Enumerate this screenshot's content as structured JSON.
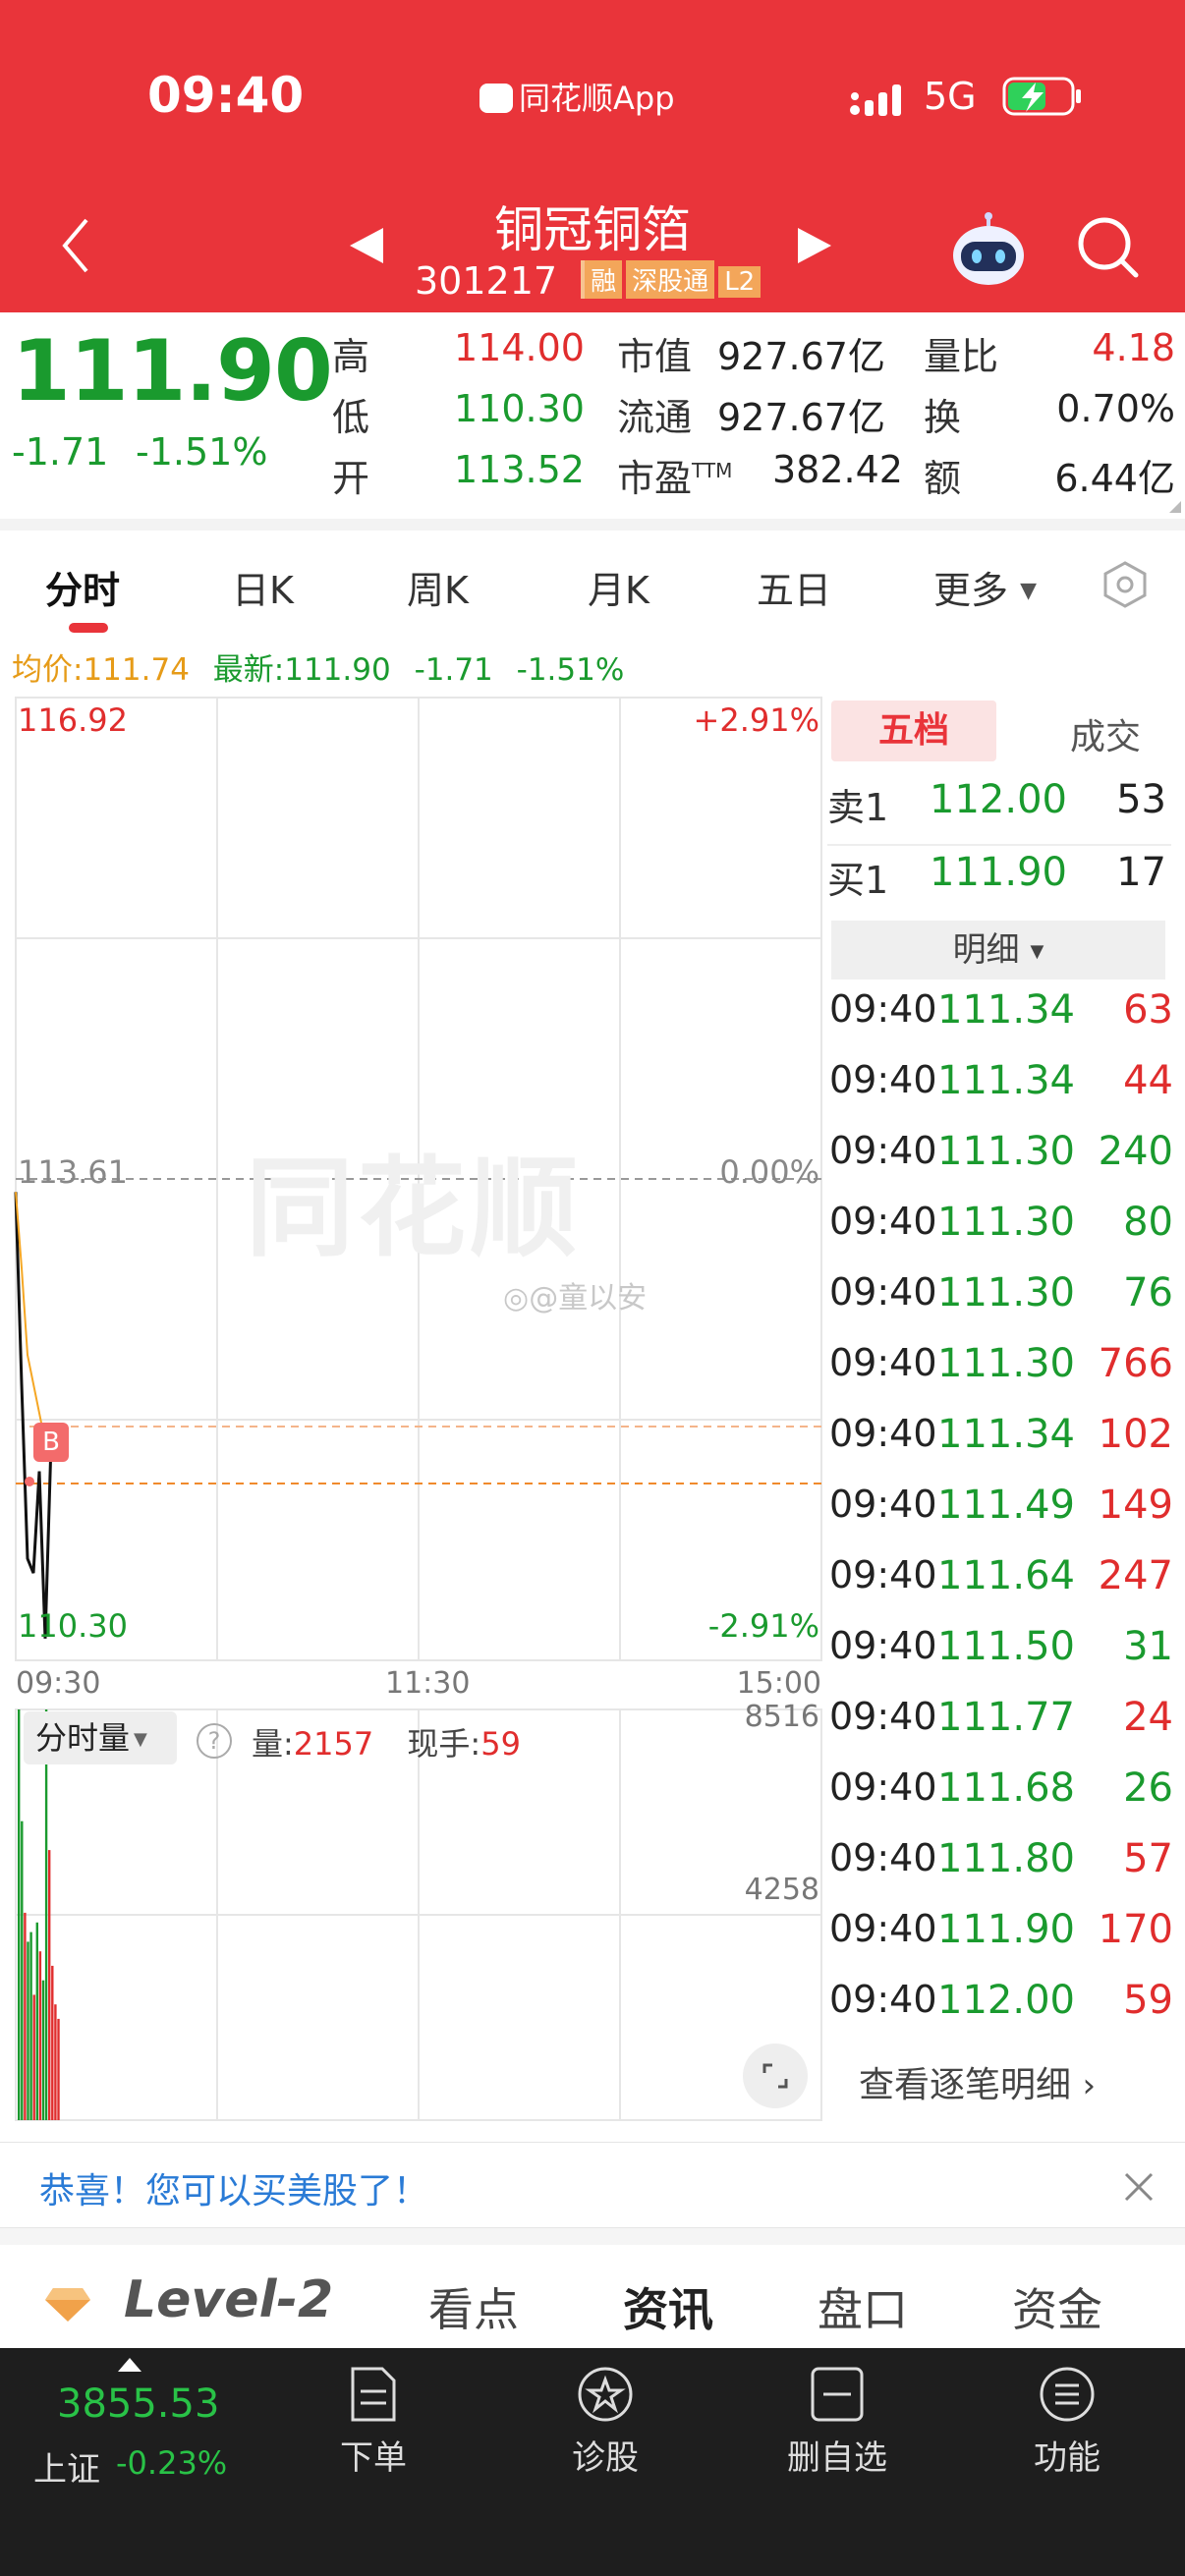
{
  "status_bar": {
    "time": "09:40",
    "app_name": "同花顺App",
    "network": "5G"
  },
  "header": {
    "stock_name": "铜冠铜箔",
    "stock_code": "301217",
    "badges": [
      "融",
      "深股通",
      "L2"
    ]
  },
  "quote": {
    "price": "111.90",
    "change": "-1.71",
    "change_pct": "-1.51%",
    "high_label": "高",
    "high": "114.00",
    "low_label": "低",
    "low": "110.30",
    "open_label": "开",
    "open": "113.52",
    "mktcap_label": "市值",
    "mktcap": "927.67亿",
    "float_label": "流通",
    "float": "927.67亿",
    "pe_label": "市盈",
    "pe_sup": "TTM",
    "pe": "382.42",
    "vr_label": "量比",
    "vr": "4.18",
    "turnover_label": "换",
    "turnover": "0.70%",
    "amount_label": "额",
    "amount": "6.44亿"
  },
  "tabs": [
    "分时",
    "日K",
    "周K",
    "月K",
    "五日",
    "更多"
  ],
  "chart_info": {
    "avg": "均价:111.74",
    "latest": "最新:111.90",
    "chg": "-1.71",
    "pct": "-1.51%"
  },
  "chart_data": {
    "type": "line",
    "y_top": "116.92",
    "y_mid": "113.61",
    "y_bottom": "110.30",
    "pct_top": "+2.91%",
    "pct_mid": "0.00%",
    "pct_bottom": "-2.91%",
    "x_labels": [
      "09:30",
      "11:30",
      "15:00"
    ],
    "ylim": [
      110.3,
      116.92
    ],
    "series": [
      {
        "values": [
          113.52,
          112.2,
          111.0,
          110.9,
          111.6,
          110.45,
          111.8,
          111.9
        ]
      },
      {
        "values": [
          113.52,
          113.0,
          112.4,
          112.2,
          112.0,
          111.8,
          111.75,
          111.74
        ]
      }
    ],
    "marker": "B",
    "volume_label": "分时量",
    "vol_label": "量:",
    "vol_value": "2157",
    "hand_label": "现手:",
    "hand_value": "59",
    "vol_max": "8516",
    "vol_mid": "4258",
    "volumes": [
      8516,
      6200,
      4300,
      3700,
      3900,
      2600,
      4100,
      3500,
      2900,
      8516,
      5600,
      3200,
      2400,
      2100
    ],
    "vol_colors": [
      "g",
      "g",
      "r",
      "g",
      "g",
      "r",
      "g",
      "r",
      "g",
      "g",
      "r",
      "r",
      "r",
      "r"
    ]
  },
  "orderbook": {
    "tab1": "五档",
    "tab2": "成交",
    "sell1_label": "卖1",
    "sell1_price": "112.00",
    "sell1_vol": "53",
    "buy1_label": "买1",
    "buy1_price": "111.90",
    "buy1_vol": "17",
    "detail_label": "明细",
    "trades": [
      {
        "t": "09:40",
        "p": "111.34",
        "v": "63",
        "c": "r"
      },
      {
        "t": "09:40",
        "p": "111.34",
        "v": "44",
        "c": "r"
      },
      {
        "t": "09:40",
        "p": "111.30",
        "v": "240",
        "c": "g"
      },
      {
        "t": "09:40",
        "p": "111.30",
        "v": "80",
        "c": "g"
      },
      {
        "t": "09:40",
        "p": "111.30",
        "v": "76",
        "c": "g"
      },
      {
        "t": "09:40",
        "p": "111.30",
        "v": "766",
        "c": "r"
      },
      {
        "t": "09:40",
        "p": "111.34",
        "v": "102",
        "c": "r"
      },
      {
        "t": "09:40",
        "p": "111.49",
        "v": "149",
        "c": "r"
      },
      {
        "t": "09:40",
        "p": "111.64",
        "v": "247",
        "c": "r"
      },
      {
        "t": "09:40",
        "p": "111.50",
        "v": "31",
        "c": "g"
      },
      {
        "t": "09:40",
        "p": "111.77",
        "v": "24",
        "c": "r"
      },
      {
        "t": "09:40",
        "p": "111.68",
        "v": "26",
        "c": "g"
      },
      {
        "t": "09:40",
        "p": "111.80",
        "v": "57",
        "c": "r"
      },
      {
        "t": "09:40",
        "p": "111.90",
        "v": "170",
        "c": "r"
      },
      {
        "t": "09:40",
        "p": "112.00",
        "v": "59",
        "c": "r"
      }
    ],
    "more_label": "查看逐笔明细"
  },
  "watermark": {
    "brand": "同花顺",
    "user": "@童以安"
  },
  "notice": {
    "text": "恭喜！您可以买美股了！"
  },
  "bottom_tabs": [
    "Level-2",
    "看点",
    "资讯",
    "盘口",
    "资金"
  ],
  "navbar": {
    "index_value": "3855.53",
    "index_name": "上证",
    "index_change": "-0.23%",
    "items": [
      "下单",
      "诊股",
      "删自选",
      "功能"
    ]
  },
  "colors": {
    "brand_red": "#e9343a",
    "up": "#e02d2d",
    "down": "#1a9a2e",
    "avg_line": "#f5a623"
  }
}
